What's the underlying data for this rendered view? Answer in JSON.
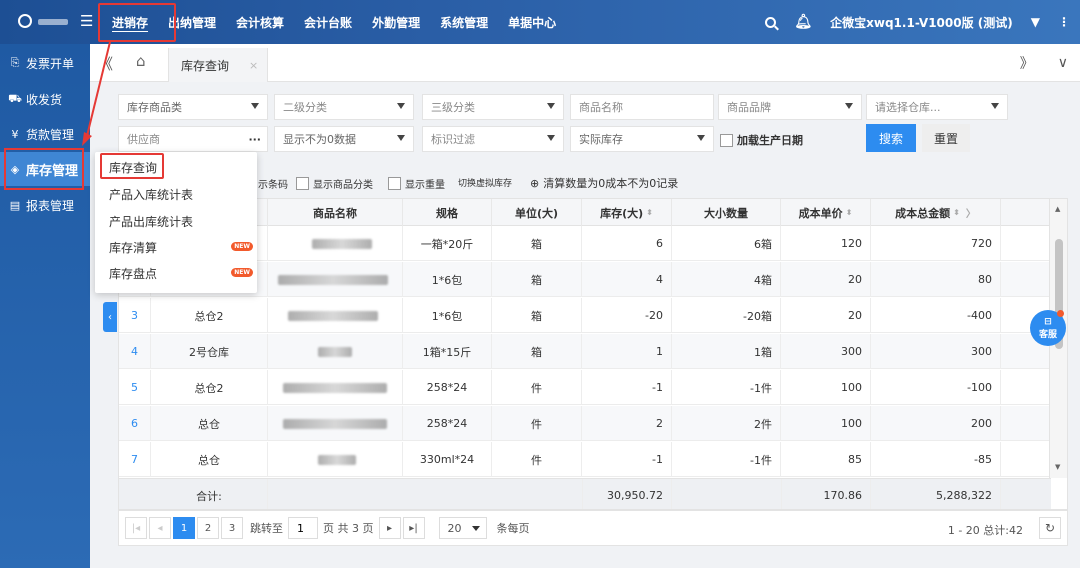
{
  "topbar": {
    "menu_icon": "☰",
    "nav": [
      "进销存",
      "出纳管理",
      "会计核算",
      "会计台账",
      "外勤管理",
      "系统管理",
      "单据中心"
    ],
    "account": "企微宝xwq1.1-V1000版 (测试)",
    "more": "⋮"
  },
  "sidebar": {
    "items": [
      {
        "label": "发票开单",
        "icon": "invoice-icon",
        "glyph": "⎘"
      },
      {
        "label": "收发货",
        "icon": "truck-icon",
        "glyph": "⛟"
      },
      {
        "label": "货款管理",
        "icon": "payment-icon",
        "glyph": "¥"
      },
      {
        "label": "库存管理",
        "icon": "layers-icon",
        "glyph": "◈"
      },
      {
        "label": "报表管理",
        "icon": "report-icon",
        "glyph": "▤"
      }
    ]
  },
  "tabs": {
    "collapse": "《",
    "home": "⌂",
    "active_tab": "库存查询",
    "close": "×",
    "right_forward": "》",
    "right_chevron": "∨"
  },
  "filters": {
    "category1": "库存商品类",
    "category2": "二级分类",
    "category3": "三级分类",
    "product_name": "商品名称",
    "brand": "商品品牌",
    "warehouse": "请选择仓库...",
    "supplier": "供应商",
    "supplier_more": "···",
    "show_mode": "显示不为0数据",
    "tag_filter": "标识过滤",
    "stock_type": "实际库存",
    "add_date": "加载生产日期",
    "search_btn": "搜索",
    "reset_btn": "重置"
  },
  "toolrow": {
    "barcode": "示条码",
    "show_category": "显示商品分类",
    "show_weight": "显示重量",
    "switch_virtual": "切换虚拟库存",
    "clear_records": "清算数量为0成本不为0记录"
  },
  "table": {
    "columns": [
      "",
      "",
      "商品名称",
      "规格",
      "单位(大)",
      "库存(大)",
      "大小数量",
      "成本单价",
      "成本总金额"
    ],
    "rows": [
      {
        "idx": "",
        "wh": "",
        "spec": "一箱*20斤",
        "unit": "箱",
        "stock": "6",
        "qty": "6箱",
        "price": "120",
        "total": "720"
      },
      {
        "idx": "",
        "wh": "",
        "spec": "1*6包",
        "unit": "箱",
        "stock": "4",
        "qty": "4箱",
        "price": "20",
        "total": "80"
      },
      {
        "idx": "3",
        "wh": "总仓2",
        "spec": "1*6包",
        "unit": "箱",
        "stock": "-20",
        "qty": "-20箱",
        "price": "20",
        "total": "-400"
      },
      {
        "idx": "4",
        "wh": "2号仓库",
        "spec": "1箱*15斤",
        "unit": "箱",
        "stock": "1",
        "qty": "1箱",
        "price": "300",
        "total": "300"
      },
      {
        "idx": "5",
        "wh": "总仓2",
        "spec": "258*24",
        "unit": "件",
        "stock": "-1",
        "qty": "-1件",
        "price": "100",
        "total": "-100"
      },
      {
        "idx": "6",
        "wh": "总仓",
        "spec": "258*24",
        "unit": "件",
        "stock": "2",
        "qty": "2件",
        "price": "100",
        "total": "200"
      },
      {
        "idx": "7",
        "wh": "总仓",
        "spec": "330ml*24",
        "unit": "件",
        "stock": "-1",
        "qty": "-1件",
        "price": "85",
        "total": "-85"
      }
    ],
    "footer": {
      "label": "合计:",
      "stock": "30,950.72",
      "price": "170.86",
      "total": "5,288,322"
    }
  },
  "pager": {
    "first": "|◂",
    "prev": "◂",
    "pages": [
      "1",
      "2",
      "3"
    ],
    "jump_label": "跳转至",
    "jump_value": "1",
    "page_of": "页 共 3 页",
    "next": "▸",
    "last": "▸|",
    "page_size": "20",
    "per_page": "条每页",
    "summary": "1 - 20 总计:42",
    "refresh": "↻"
  },
  "dropdown": {
    "items": [
      {
        "label": "库存查询"
      },
      {
        "label": "产品入库统计表"
      },
      {
        "label": "产品出库统计表"
      },
      {
        "label": "库存清算",
        "badge": "NEW"
      },
      {
        "label": "库存盘点",
        "badge": "NEW"
      }
    ]
  },
  "side_tab": "‹",
  "kefu": {
    "icon": "⊟",
    "label": "客服"
  },
  "colors": {
    "primary": "#2d8cf0",
    "highlight": "#e53935",
    "topbar": "#1d4f94"
  }
}
